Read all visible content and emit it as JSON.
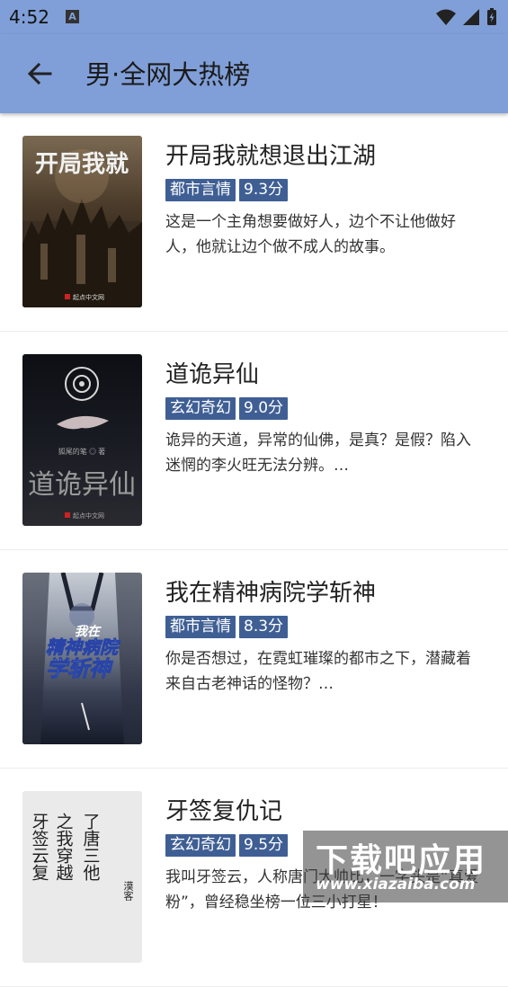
{
  "status_bar": {
    "time": "4:52",
    "notification_icon": "A"
  },
  "app_bar": {
    "title": "男·全网大热榜"
  },
  "books": [
    {
      "title": "开局我就想退出江湖",
      "genre": "都市言情",
      "score": "9.3分",
      "description": "这是一个主角想要做好人，边个不让他做好人，他就让边个做不成人的故事。",
      "cover": {
        "title": "开局我就",
        "publisher": "起点中文网"
      }
    },
    {
      "title": "道诡异仙",
      "genre": "玄幻奇幻",
      "score": "9.0分",
      "description": "诡异的天道，异常的仙佛，是真？是假？陷入迷惘的李火旺无法分辨。…",
      "cover": {
        "title": "道诡异仙",
        "author": "狐尾的笔 ◎ 著",
        "publisher": "起点中文网"
      }
    },
    {
      "title": "我在精神病院学斩神",
      "genre": "都市言情",
      "score": "8.3分",
      "description": "你是否想过，在霓虹璀璨的都市之下，潜藏着来自古老神话的怪物？…",
      "cover": {
        "title_top": "我在",
        "title_mid": "精神病院",
        "title_bottom": "学斩神"
      }
    },
    {
      "title": "牙签复仇记",
      "genre": "玄幻奇幻",
      "score": "9.5分",
      "description": "我叫牙签云，人称唐门大帅比，一字头是“真爱粉”，曾经稳坐榜一位三小打星！",
      "cover": {
        "col1": "了唐三他",
        "col2": "之我穿越",
        "col3": "牙签云复",
        "seal": "漠客"
      }
    }
  ],
  "watermark": {
    "logo": "下载吧应用",
    "url": "www.xiazaiba.com"
  },
  "colors": {
    "app_bar": "#809fd8",
    "tag_bg": "#3f5f94"
  }
}
